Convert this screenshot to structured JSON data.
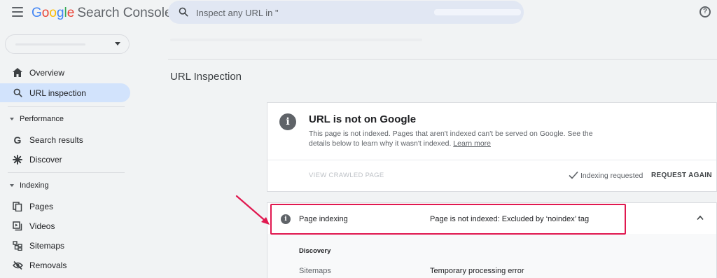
{
  "header": {
    "logo_google": "Google",
    "logo_product": "Search Console",
    "search_placeholder": "Inspect any URL in \""
  },
  "sidebar": {
    "items": [
      {
        "label": "Overview",
        "icon": "home-icon"
      },
      {
        "label": "URL inspection",
        "icon": "search-icon",
        "active": true
      }
    ],
    "performance": {
      "label": "Performance",
      "items": [
        {
          "label": "Search results",
          "icon": "google-g-icon"
        },
        {
          "label": "Discover",
          "icon": "asterisk-icon"
        }
      ]
    },
    "indexing": {
      "label": "Indexing",
      "items": [
        {
          "label": "Pages",
          "icon": "pages-icon"
        },
        {
          "label": "Videos",
          "icon": "video-icon"
        },
        {
          "label": "Sitemaps",
          "icon": "sitemap-icon"
        },
        {
          "label": "Removals",
          "icon": "eye-off-icon"
        }
      ]
    }
  },
  "main": {
    "title": "URL Inspection",
    "status_card": {
      "title": "URL is not on Google",
      "description": "This page is not indexed. Pages that aren't indexed can't be served on Google. See the details below to learn why it wasn't indexed.",
      "learn_more": "Learn more",
      "view_crawled": "VIEW CRAWLED PAGE",
      "indexing_requested": "Indexing requested",
      "request_again": "REQUEST AGAIN"
    },
    "page_indexing": {
      "label": "Page indexing",
      "value": "Page is not indexed: Excluded by ‘noindex’ tag",
      "discovery_heading": "Discovery",
      "sitemaps_label": "Sitemaps",
      "sitemaps_value": "Temporary processing error"
    }
  },
  "colors": {
    "accent_active": "#d2e3fc",
    "highlight": "#e0184f",
    "search_bg": "#e1e7f3"
  }
}
